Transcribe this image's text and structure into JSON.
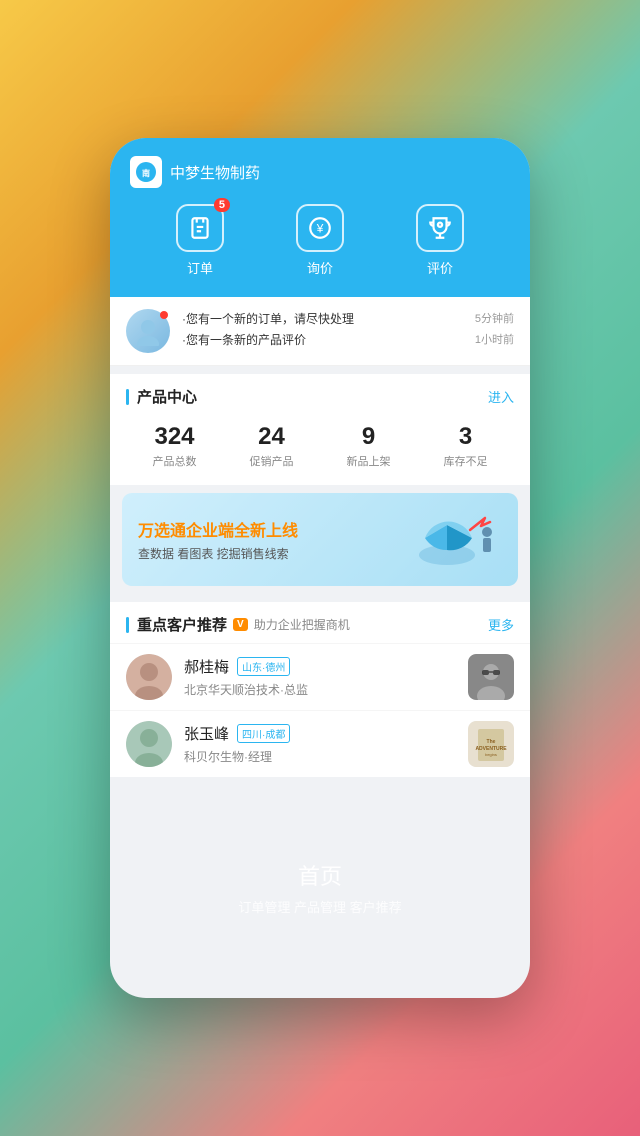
{
  "app": {
    "background": "gradient multicolor"
  },
  "header": {
    "company_name": "中梦生物制药",
    "nav": [
      {
        "id": "orders",
        "label": "订单",
        "icon": "clipboard",
        "badge": "5"
      },
      {
        "id": "inquiry",
        "label": "询价",
        "icon": "yen-circle"
      },
      {
        "id": "review",
        "label": "评价",
        "icon": "trophy"
      }
    ]
  },
  "notifications": [
    {
      "text": "·您有一个新的订单，请尽快处理",
      "time": "5分钟前"
    },
    {
      "text": "·您有一条新的产品评价",
      "time": "1小时前"
    }
  ],
  "product_center": {
    "title": "产品中心",
    "link": "进入",
    "stats": [
      {
        "number": "324",
        "label": "产品总数"
      },
      {
        "number": "24",
        "label": "促销产品"
      },
      {
        "number": "9",
        "label": "新品上架"
      },
      {
        "number": "3",
        "label": "库存不足"
      }
    ]
  },
  "banner": {
    "title_prefix": "万选通企业端",
    "title_highlight": "全新上线",
    "subtitle": "查数据 看图表 挖掘销售线索"
  },
  "customers": {
    "title": "重点客户推荐",
    "v_badge": "V",
    "subtitle": "助力企业把握商机",
    "more": "更多",
    "list": [
      {
        "name": "郝桂梅",
        "region": "山东·德州",
        "company": "北京华天顺治技术·总监",
        "avatar_color": "#c8a898"
      },
      {
        "name": "张玉峰",
        "region": "四川·成都",
        "company": "科贝尔生物·经理",
        "avatar_color": "#a8c0b8"
      }
    ]
  },
  "bottom": {
    "title": "首页",
    "subtitle": "订单管理 产品管理 客户推荐"
  }
}
